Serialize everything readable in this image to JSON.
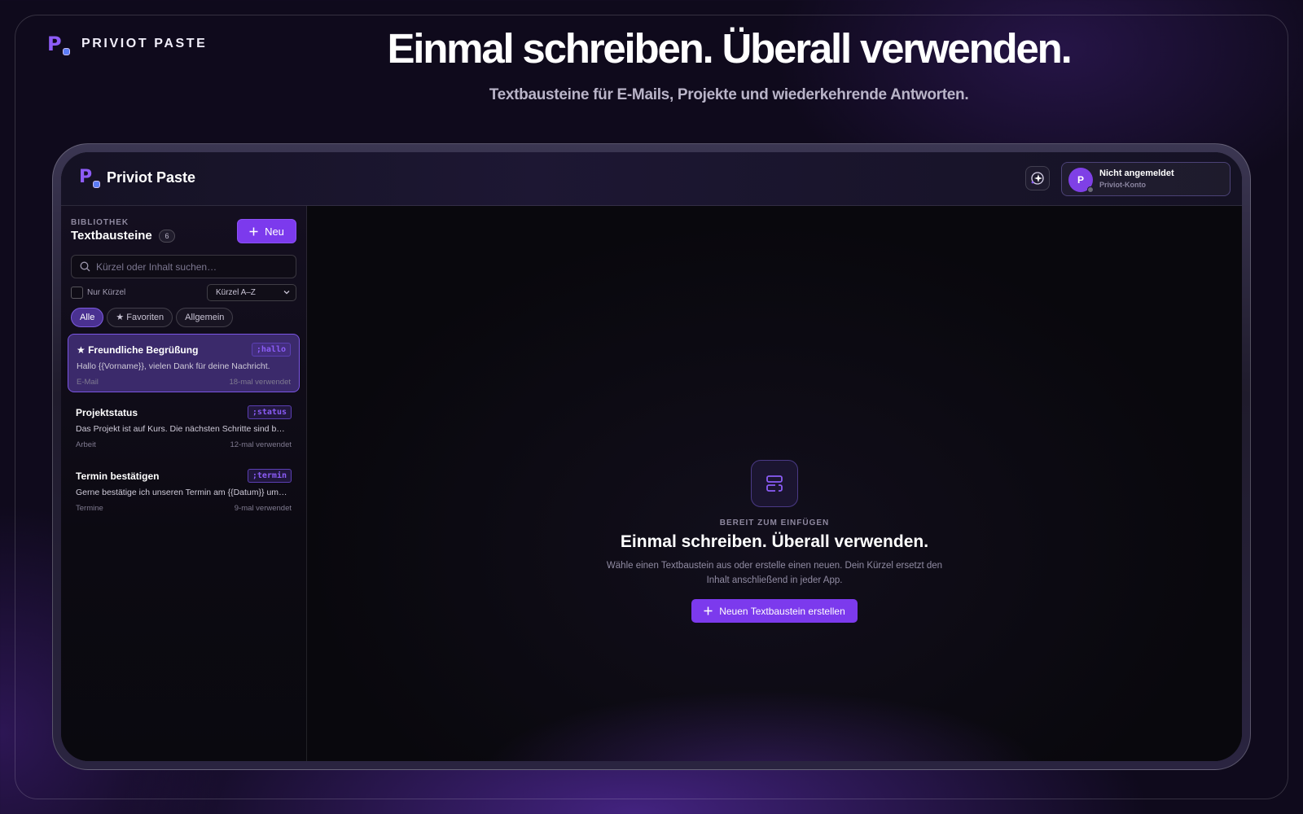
{
  "marketing": {
    "brand_name": "PRIVIOT PASTE",
    "headline": "Einmal schreiben. Überall verwenden.",
    "subheadline": "Textbausteine für E-Mails, Projekte und wiederkehrende Antworten."
  },
  "topbar": {
    "app_name": "Priviot Paste",
    "account": {
      "avatar_initial": "P",
      "name": "Nicht angemeldet",
      "subtitle": "Priviot-Konto"
    }
  },
  "sidebar": {
    "eyebrow": "BIBLIOTHEK",
    "title": "Textbausteine",
    "count": "6",
    "new_label": "Neu",
    "search_placeholder": "Kürzel oder Inhalt suchen…",
    "only_shortcuts_label": "Nur Kürzel",
    "sort_value": "Kürzel A–Z",
    "filters": [
      "Alle",
      "★ Favoriten",
      "Allgemein"
    ],
    "snippets": [
      {
        "title": "★ Freundliche Begrüßung",
        "shortcut": ";hallo",
        "text": "Hallo {{Vorname}}, vielen Dank für deine Nachricht.",
        "category": "E-Mail",
        "uses": "18-mal verwendet"
      },
      {
        "title": "Projektstatus",
        "shortcut": ";status",
        "text": "Das Projekt ist auf Kurs. Die nächsten Schritte sind b…",
        "category": "Arbeit",
        "uses": "12-mal verwendet"
      },
      {
        "title": "Termin bestätigen",
        "shortcut": ";termin",
        "text": "Gerne bestätige ich unseren Termin am {{Datum}} um…",
        "category": "Termine",
        "uses": "9-mal verwendet"
      }
    ]
  },
  "empty_state": {
    "eyebrow": "BEREIT ZUM EINFÜGEN",
    "title": "Einmal schreiben. Überall verwenden.",
    "description": "Wähle einen Textbaustein aus oder erstelle einen neuen. Dein Kürzel ersetzt den Inhalt anschließend in jeder App.",
    "cta_label": "Neuen Textbaustein erstellen"
  },
  "colors": {
    "accent": "#7c3aed",
    "background": "#0f0a1c"
  },
  "icons": [
    "logo-icon",
    "ai-sparkle-icon",
    "plus-icon",
    "search-icon",
    "chevron-down-icon",
    "snippet-icon"
  ]
}
